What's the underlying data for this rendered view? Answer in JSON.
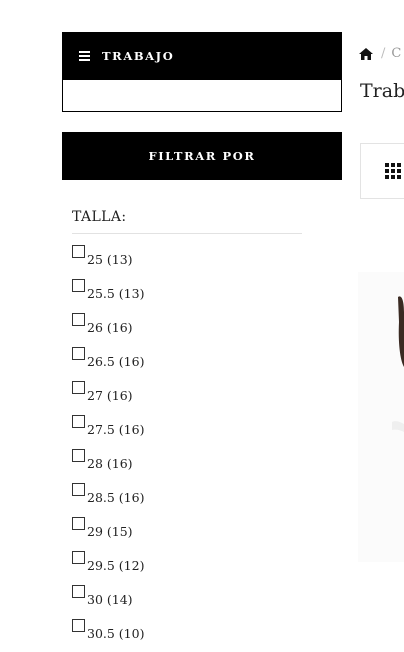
{
  "categories": {
    "title": "TRABAJO"
  },
  "filter": {
    "label": "FILTRAR POR"
  },
  "size_filter": {
    "title": "TALLA:",
    "options": [
      {
        "label": "25 (13)"
      },
      {
        "label": "25.5 (13)"
      },
      {
        "label": "26 (16)"
      },
      {
        "label": "26.5 (16)"
      },
      {
        "label": "27 (16)"
      },
      {
        "label": "27.5 (16)"
      },
      {
        "label": "28 (16)"
      },
      {
        "label": "28.5 (16)"
      },
      {
        "label": "29 (15)"
      },
      {
        "label": "29.5 (12)"
      },
      {
        "label": "30 (14)"
      },
      {
        "label": "30.5 (10)"
      }
    ]
  },
  "breadcrumb": {
    "separator": "/",
    "current": "C"
  },
  "page": {
    "title": "Trab"
  },
  "icons": {
    "menu": "hamburger-icon",
    "home": "home-icon",
    "grid_view": "grid-icon"
  }
}
